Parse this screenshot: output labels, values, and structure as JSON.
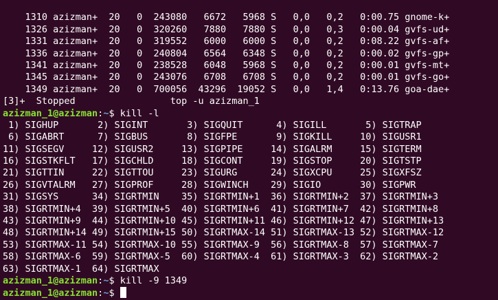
{
  "top_rows": [
    "    1310 azizman+  20   0  243080   6672   5968 S   0,0   0,2   0:00.75 gnome-k+",
    "    1326 azizman+  20   0  320260   7880   7880 S   0,0   0,3   0:00.04 gvfs-ud+",
    "    1331 azizman+  20   0  319552   6000   6000 S   0,0   0,2   0:08.22 gvfs-af+",
    "    1336 azizman+  20   0  240804   6564   6348 S   0,0   0,2   0:00.02 gvfs-gp+",
    "    1341 azizman+  20   0  238528   6048   5968 S   0,0   0,2   0:00.01 gvfs-mt+",
    "    1345 azizman+  20   0  243076   6708   6708 S   0,0   0,2   0:00.01 gvfs-go+",
    "    1349 azizman+  20   0  700056  43296  19052 S   0,0   1,4   0:13.76 goa-dae+"
  ],
  "job_status": "[3]+  Stopped                 top -u azizman_1",
  "prompt": {
    "user_host": "azizman_1@azizman",
    "colon": ":",
    "path": "~",
    "symbol": "$ "
  },
  "commands": {
    "kill_list": "kill -l",
    "kill_pid": "kill -9 1349"
  },
  "signal_rows": [
    " 1) SIGHUP       2) SIGINT       3) SIGQUIT      4) SIGILL       5) SIGTRAP",
    " 6) SIGABRT      7) SIGBUS       8) SIGFPE       9) SIGKILL     10) SIGUSR1",
    "11) SIGSEGV     12) SIGUSR2     13) SIGPIPE     14) SIGALRM     15) SIGTERM",
    "16) SIGSTKFLT   17) SIGCHLD     18) SIGCONT     19) SIGSTOP     20) SIGTSTP",
    "21) SIGTTIN     22) SIGTTOU     23) SIGURG      24) SIGXCPU     25) SIGXFSZ",
    "26) SIGVTALRM   27) SIGPROF     28) SIGWINCH    29) SIGIO       30) SIGPWR",
    "31) SIGSYS      34) SIGRTMIN    35) SIGRTMIN+1  36) SIGRTMIN+2  37) SIGRTMIN+3",
    "38) SIGRTMIN+4  39) SIGRTMIN+5  40) SIGRTMIN+6  41) SIGRTMIN+7  42) SIGRTMIN+8",
    "43) SIGRTMIN+9  44) SIGRTMIN+10 45) SIGRTMIN+11 46) SIGRTMIN+12 47) SIGRTMIN+13",
    "48) SIGRTMIN+14 49) SIGRTMIN+15 50) SIGRTMAX-14 51) SIGRTMAX-13 52) SIGRTMAX-12",
    "53) SIGRTMAX-11 54) SIGRTMAX-10 55) SIGRTMAX-9  56) SIGRTMAX-8  57) SIGRTMAX-7",
    "58) SIGRTMAX-6  59) SIGRTMAX-5  60) SIGRTMAX-4  61) SIGRTMAX-3  62) SIGRTMAX-2",
    "63) SIGRTMAX-1  64) SIGRTMAX"
  ],
  "colors": {
    "background": "#300a24",
    "text": "#ffffff",
    "prompt_user": "#8ae234",
    "prompt_path": "#729fcf"
  }
}
